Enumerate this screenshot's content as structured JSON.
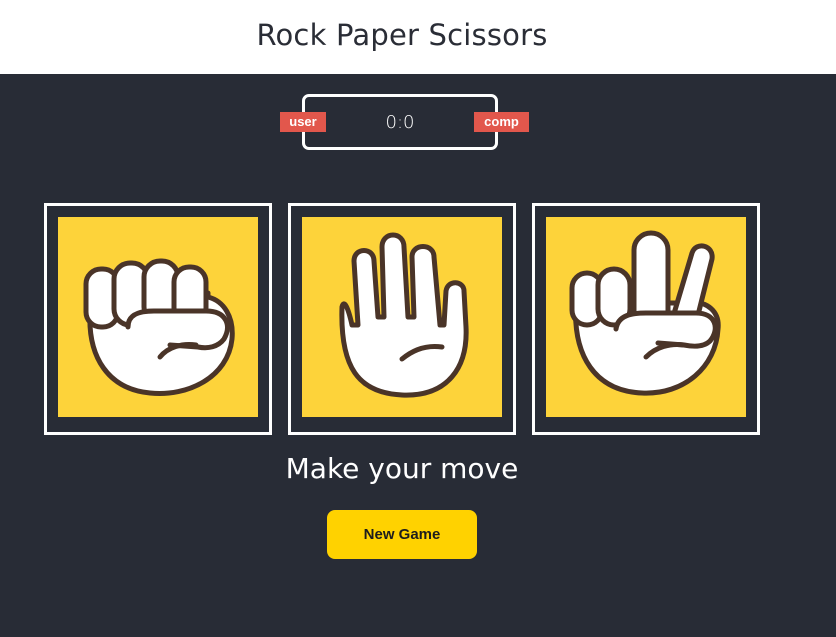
{
  "header": {
    "title": "Rock Paper Scissors"
  },
  "score": {
    "value": "0:0",
    "user_label": "user",
    "comp_label": "comp"
  },
  "choices": [
    {
      "id": "rock",
      "icon": "fist-hand-icon"
    },
    {
      "id": "paper",
      "icon": "open-hand-icon"
    },
    {
      "id": "scissors",
      "icon": "peace-hand-icon"
    }
  ],
  "message": "Make your move",
  "controls": {
    "new_game_label": "New Game"
  },
  "colors": {
    "background": "#282c36",
    "tile": "#fdd33a",
    "badge": "#e2574c",
    "button": "#ffd200",
    "outline": "#4a3428"
  }
}
